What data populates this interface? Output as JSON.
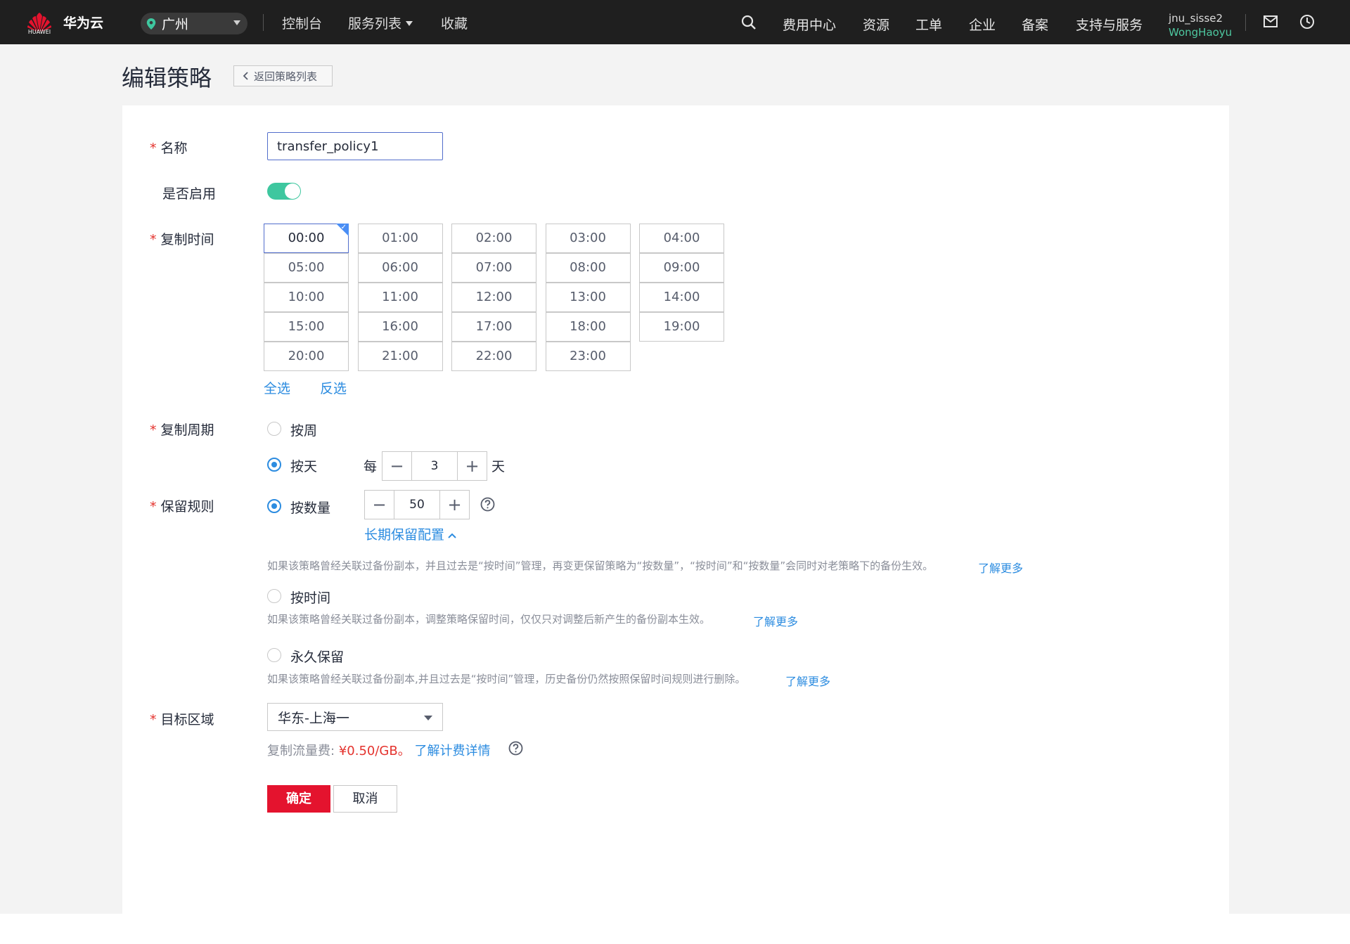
{
  "topbar": {
    "brand_small": "HUAWEI",
    "brand_name": "华为云",
    "region": "广州",
    "nav_left": [
      "控制台",
      "服务列表",
      "收藏"
    ],
    "nav_right": [
      "费用中心",
      "资源",
      "工单",
      "企业",
      "备案",
      "支持与服务"
    ],
    "username": "jnu_sisse2",
    "display_name": "WongHaoyu"
  },
  "page": {
    "title": "编辑策略",
    "back_label": "返回策略列表"
  },
  "form": {
    "name_label": "名称",
    "name_value": "transfer_policy1",
    "enabled_label": "是否启用",
    "enabled": true,
    "time_label": "复制时间",
    "times": [
      "00:00",
      "01:00",
      "02:00",
      "03:00",
      "04:00",
      "05:00",
      "06:00",
      "07:00",
      "08:00",
      "09:00",
      "10:00",
      "11:00",
      "12:00",
      "13:00",
      "14:00",
      "15:00",
      "16:00",
      "17:00",
      "18:00",
      "19:00",
      "20:00",
      "21:00",
      "22:00",
      "23:00"
    ],
    "selected_time": "00:00",
    "select_all": "全选",
    "invert_select": "反选",
    "cycle_label": "复制周期",
    "cycle_week": "按周",
    "cycle_day": "按天",
    "cycle_every": "每",
    "cycle_value": "3",
    "cycle_unit": "天",
    "retention_label": "保留规则",
    "retention_count": "按数量",
    "retention_count_value": "50",
    "long_term_config": "长期保留配置",
    "note_count": "如果该策略曾经关联过备份副本，并且过去是“按时间”管理，再变更保留策略为“按数量”，“按时间”和“按数量”会同时对老策略下的备份生效。",
    "retention_time": "按时间",
    "note_time": "如果该策略曾经关联过备份副本，调整策略保留时间，仅仅只对调整后新产生的备份副本生效。",
    "retention_forever": "永久保留",
    "note_forever": "如果该策略曾经关联过备份副本,并且过去是“按时间”管理，历史备份仍然按照保留时间规则进行删除。",
    "learn_more": "了解更多",
    "target_label": "目标区域",
    "target_value": "华东-上海一",
    "fee_label": "复制流量费:",
    "fee_price": "¥0.50/GB。",
    "fee_link": "了解计费详情",
    "ok": "确定",
    "cancel": "取消"
  },
  "colors": {
    "accent_blue": "#2c8ce0",
    "toggle_green": "#3ec79f",
    "required_red": "#e4332e",
    "primary_button": "#e4132e",
    "topbar": "#1f1f1f"
  }
}
